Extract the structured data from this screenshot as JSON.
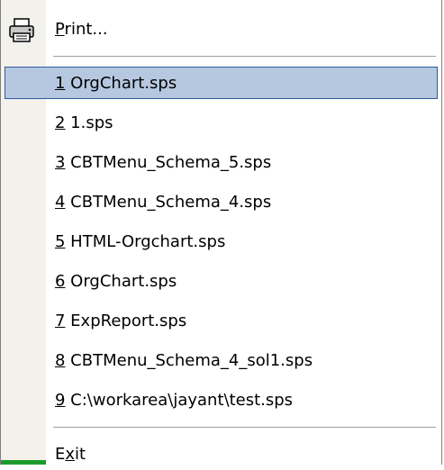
{
  "menu": {
    "print": {
      "mnemonic": "P",
      "rest": "rint...",
      "icon": "printer-icon"
    },
    "recent_files": [
      {
        "num": "1",
        "name": " OrgChart.sps"
      },
      {
        "num": "2",
        "name": " 1.sps"
      },
      {
        "num": "3",
        "name": " CBTMenu_Schema_5.sps"
      },
      {
        "num": "4",
        "name": " CBTMenu_Schema_4.sps"
      },
      {
        "num": "5",
        "name": " HTML-Orgchart.sps"
      },
      {
        "num": "6",
        "name": " OrgChart.sps"
      },
      {
        "num": "7",
        "name": " ExpReport.sps"
      },
      {
        "num": "8",
        "name": " CBTMenu_Schema_4_sol1.sps"
      },
      {
        "num": "9",
        "name": " C:\\workarea\\jayant\\test.sps"
      }
    ],
    "exit": {
      "pre": "E",
      "mnemonic": "x",
      "post": "it"
    },
    "colors": {
      "highlight": "#b6c8e0",
      "highlight_border": "#2f5aa0",
      "icon_strip": "#f2f1ec"
    }
  }
}
